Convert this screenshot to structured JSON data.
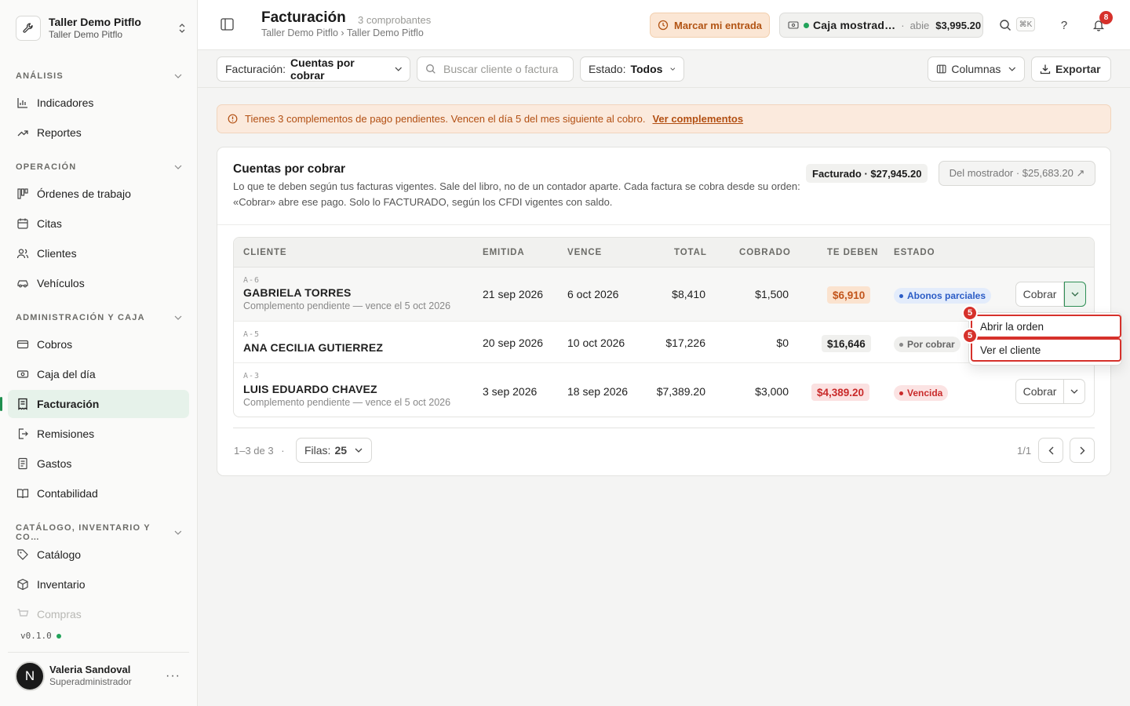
{
  "sidebar": {
    "org_name": "Taller Demo Pitflo",
    "org_sub": "Taller Demo Pitflo",
    "sections": {
      "analisis": "ANÁLISIS",
      "operacion": "OPERACIÓN",
      "admin": "ADMINISTRACIÓN Y CAJA",
      "catalogo": "CATÁLOGO, INVENTARIO Y CO…"
    },
    "items": {
      "indicadores": "Indicadores",
      "reportes": "Reportes",
      "ordenes": "Órdenes de trabajo",
      "citas": "Citas",
      "clientes": "Clientes",
      "vehiculos": "Vehículos",
      "cobros": "Cobros",
      "caja": "Caja del día",
      "facturacion": "Facturación",
      "remisiones": "Remisiones",
      "gastos": "Gastos",
      "contabilidad": "Contabilidad",
      "catalogo": "Catálogo",
      "inventario": "Inventario",
      "compras": "Compras"
    },
    "version": "v0.1.0",
    "user": {
      "name": "Valeria Sandoval",
      "role": "Superadministrador",
      "initial": "N"
    }
  },
  "header": {
    "title": "Facturación",
    "count": "3 comprobantes",
    "breadcrumb": "Taller Demo Pitflo › Taller Demo Pitflo",
    "entrada_label": "Marcar mi entrada",
    "caja_name": "Caja mostrad…",
    "caja_sep": "·",
    "caja_state": "abie",
    "caja_amount": "$3,995.20",
    "shortcut": "⌘K",
    "help": "?",
    "notifications": "8"
  },
  "filters": {
    "facturacion_label": "Facturación:",
    "facturacion_value": "Cuentas por cobrar",
    "search_placeholder": "Buscar cliente o factura",
    "estado_label": "Estado:",
    "estado_value": "Todos",
    "columnas": "Columnas",
    "exportar": "Exportar"
  },
  "alert": {
    "message": "Tienes 3 complementos de pago pendientes. Vencen el día 5 del mes siguiente al cobro.",
    "link": "Ver complementos"
  },
  "card": {
    "title": "Cuentas por cobrar",
    "description": "Lo que te deben según tus facturas vigentes. Sale del libro, no de un contador aparte. Cada factura se cobra desde su orden: «Cobrar» abre ese pago. Solo lo FACTURADO, según los CFDI vigentes con saldo.",
    "facturado": "Facturado · $27,945.20",
    "mostrador": "Del mostrador · $25,683.20 ↗"
  },
  "table": {
    "columns": [
      "CLIENTE",
      "EMITIDA",
      "VENCE",
      "TOTAL",
      "COBRADO",
      "TE DEBEN",
      "ESTADO"
    ],
    "rows": [
      {
        "code": "A-6",
        "client": "GABRIELA TORRES",
        "note": "Complemento pendiente — vence el 5 oct 2026",
        "emitida": "21 sep 2026",
        "vence": "6 oct 2026",
        "total": "$8,410",
        "cobrado": "$1,500",
        "owe": "$6,910",
        "estado": "Abonos parciales",
        "action": "Cobrar"
      },
      {
        "code": "A-5",
        "client": "ANA CECILIA GUTIERREZ",
        "note": "",
        "emitida": "20 sep 2026",
        "vence": "10 oct 2026",
        "total": "$17,226",
        "cobrado": "$0",
        "owe": "$16,646",
        "estado": "Por cobrar",
        "action": ""
      },
      {
        "code": "A-3",
        "client": "LUIS EDUARDO CHAVEZ",
        "note": "Complemento pendiente — vence el 5 oct 2026",
        "emitida": "3 sep 2026",
        "vence": "18 sep 2026",
        "total": "$7,389.20",
        "cobrado": "$3,000",
        "owe": "$4,389.20",
        "estado": "Vencida",
        "action": "Cobrar"
      }
    ]
  },
  "pagination": {
    "info": "1–3 de 3",
    "sep": "·",
    "rows_label": "Filas:",
    "rows_value": "25",
    "page": "1/1"
  },
  "menu": {
    "items": [
      "Abrir la orden",
      "Ver el cliente"
    ],
    "marker": "5"
  },
  "colors": {
    "accent": "#1f8f4f",
    "warning": "#b24f12",
    "danger": "#d6312b",
    "info": "#2b5cc6"
  }
}
